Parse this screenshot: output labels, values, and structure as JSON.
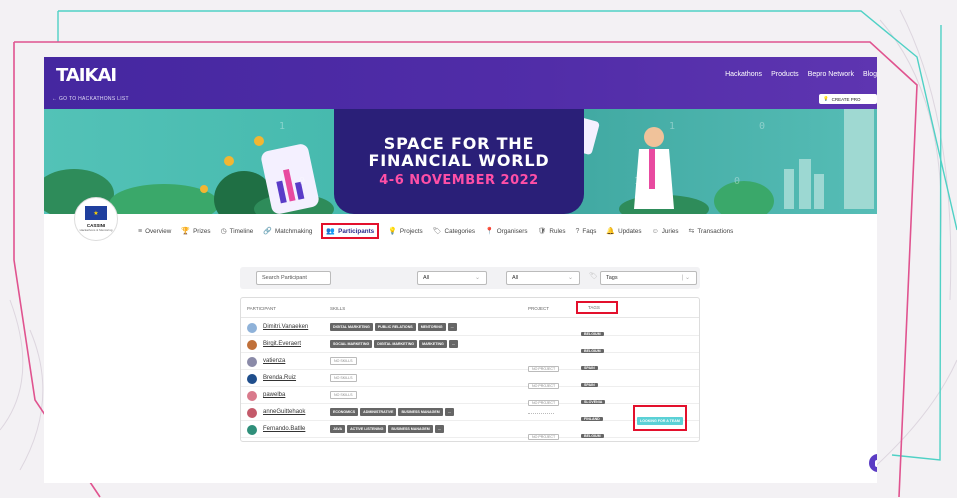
{
  "app": {
    "logo": "TAIKAI"
  },
  "topnav": [
    "Hackathons",
    "Products",
    "Bepro Network",
    "Blog"
  ],
  "back_link": "← GO TO HACKATHONS LIST",
  "create_button": "CREATE PRO",
  "banner": {
    "title_line1": "SPACE FOR THE",
    "title_line2": "FINANCIAL WORLD",
    "date": "4-6 NOVEMBER 2022"
  },
  "org": {
    "name": "CASSINI",
    "subtitle": "Hackathons & Mentoring"
  },
  "tabs": [
    {
      "label": "Overview",
      "icon": "≡"
    },
    {
      "label": "Prizes",
      "icon": "🏆"
    },
    {
      "label": "Timeline",
      "icon": "◷"
    },
    {
      "label": "Matchmaking",
      "icon": "🔗"
    },
    {
      "label": "Participants",
      "icon": "👥"
    },
    {
      "label": "Projects",
      "icon": "💡"
    },
    {
      "label": "Categories",
      "icon": "🏷"
    },
    {
      "label": "Organisers",
      "icon": "📍"
    },
    {
      "label": "Rules",
      "icon": "🛡"
    },
    {
      "label": "Faqs",
      "icon": "?"
    },
    {
      "label": "Updates",
      "icon": "🔔"
    },
    {
      "label": "Juries",
      "icon": "☺"
    },
    {
      "label": "Transactions",
      "icon": "⇆"
    }
  ],
  "filters": {
    "search_placeholder": "Search Participant",
    "select1": "All",
    "select2": "All",
    "tags_placeholder": "Tags"
  },
  "table": {
    "headers": {
      "participant": "PARTICIPANT",
      "skills": "SKILLS",
      "project": "PROJECT",
      "tags": "TAGS"
    },
    "rows": [
      {
        "name": "Dimitri.Vanaeken",
        "avatar_color": "#8fb2d9",
        "skills": [
          "DIGITAL MARKETING",
          "PUBLIC RELATIONS",
          "MENTORING",
          "..."
        ],
        "project": "",
        "tag": "BELGIUM",
        "status": ""
      },
      {
        "name": "Birgit.Everaert",
        "avatar_color": "#c0703a",
        "skills": [
          "SOCIAL MARKETING",
          "DIGITAL MARKETING",
          "MARKETING",
          "..."
        ],
        "project": "",
        "tag": "BELGIUM",
        "status": ""
      },
      {
        "name": "vatienza",
        "avatar_color": "#8a8aa8",
        "skills": [
          "NO SKILLS"
        ],
        "project": "NO PROJECT",
        "tag": "SPAIN",
        "status": ""
      },
      {
        "name": "Brenda.Ruiz",
        "avatar_color": "#1f4e8c",
        "skills": [
          "NO SKILLS"
        ],
        "project": "NO PROJECT",
        "tag": "SPAIN",
        "status": ""
      },
      {
        "name": "pawelba",
        "avatar_color": "#d97a8c",
        "skills": [
          "NO SKILLS"
        ],
        "project": "NO PROJECT",
        "tag": "SLOVENIA",
        "status": ""
      },
      {
        "name": "anneGuittehaok",
        "avatar_color": "#c45a6a",
        "skills": [
          "ECONOMICS",
          "ADMINISTRATIVE",
          "BUSINESS MANAGEM",
          "..."
        ],
        "project": "",
        "tag": "FINLAND",
        "status": "LOOKING FOR A TEAM"
      },
      {
        "name": "Fernando.Batlle",
        "avatar_color": "#2f8f7a",
        "skills": [
          "JAVA",
          "ACTIVE LISTENING",
          "BUSINESS MANAGEM",
          "..."
        ],
        "project": "NO PROJECT",
        "tag": "BELGIUM",
        "status": ""
      }
    ]
  },
  "colors": {
    "topbar": "#512da8",
    "highlight": "#e3102c",
    "frame_pink": "#e0538f",
    "frame_teal": "#4fd1c5",
    "looking_chip": "#5bd1d6"
  }
}
